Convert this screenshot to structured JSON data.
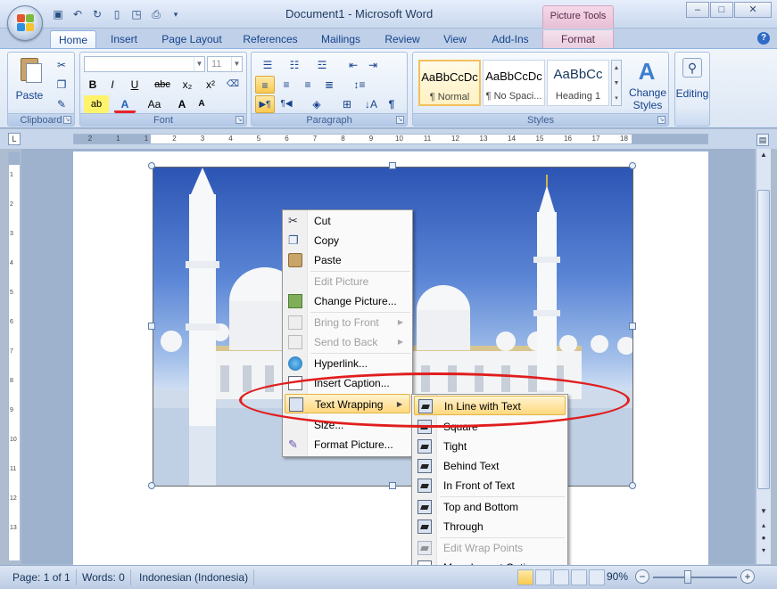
{
  "window": {
    "title": "Document1 - Microsoft Word",
    "context_tools": "Picture Tools",
    "controls": {
      "minimize": "–",
      "maximize": "□",
      "close": "✕"
    }
  },
  "quick_access": [
    "save-icon",
    "undo-icon",
    "redo-icon",
    "print-preview-icon",
    "spelling-icon",
    "print-icon",
    "customize-icon"
  ],
  "tabs": [
    "Home",
    "Insert",
    "Page Layout",
    "References",
    "Mailings",
    "Review",
    "View",
    "Add-Ins",
    "Format"
  ],
  "active_tab": "Home",
  "ribbon": {
    "clipboard": {
      "label": "Clipboard",
      "paste": "Paste"
    },
    "font": {
      "label": "Font",
      "font_name": "",
      "font_size": "11",
      "bold": "B",
      "italic": "I",
      "underline": "U",
      "strike": "abc",
      "subscript": "x₂",
      "superscript": "x²",
      "grow": "A",
      "shrink": "A",
      "case": "Aa"
    },
    "paragraph": {
      "label": "Paragraph"
    },
    "styles": {
      "label": "Styles",
      "items": [
        {
          "sample": "AaBbCcDc",
          "name": "¶ Normal"
        },
        {
          "sample": "AaBbCcDc",
          "name": "¶ No Spaci..."
        },
        {
          "sample": "AaBbCc",
          "name": "Heading 1"
        }
      ],
      "change_styles_1": "Change",
      "change_styles_2": "Styles"
    },
    "editing": {
      "label": "Editing"
    }
  },
  "ruler": {
    "numbers": [
      "2",
      "1",
      "1",
      "2",
      "3",
      "4",
      "5",
      "6",
      "7",
      "8",
      "9",
      "10",
      "11",
      "12",
      "13",
      "14",
      "15",
      "16",
      "17",
      "18"
    ],
    "vnumbers": [
      "1",
      "2",
      "3",
      "4",
      "5",
      "6",
      "7",
      "8",
      "9",
      "10",
      "11",
      "12",
      "13"
    ]
  },
  "context_menu": {
    "items": [
      {
        "label": "Cut",
        "icon": "scissors-icon",
        "enabled": true
      },
      {
        "label": "Copy",
        "icon": "copy-icon",
        "enabled": true
      },
      {
        "label": "Paste",
        "icon": "paste-icon",
        "enabled": true
      },
      {
        "label": "Edit Picture",
        "icon": "",
        "enabled": false
      },
      {
        "label": "Change Picture...",
        "icon": "change-picture-icon",
        "enabled": true
      },
      {
        "label": "Bring to Front",
        "icon": "bring-front-icon",
        "enabled": false,
        "submenu": true
      },
      {
        "label": "Send to Back",
        "icon": "send-back-icon",
        "enabled": false,
        "submenu": true
      },
      {
        "label": "Hyperlink...",
        "icon": "hyperlink-icon",
        "enabled": true
      },
      {
        "label": "Insert Caption...",
        "icon": "caption-icon",
        "enabled": true
      },
      {
        "label": "Text Wrapping",
        "icon": "text-wrapping-icon",
        "enabled": true,
        "submenu": true,
        "highlighted": true
      },
      {
        "label": "Size...",
        "icon": "",
        "enabled": true
      },
      {
        "label": "Format Picture...",
        "icon": "format-picture-icon",
        "enabled": true
      }
    ]
  },
  "wrap_submenu": {
    "items": [
      {
        "label": "In Line with Text",
        "enabled": true,
        "highlighted": true
      },
      {
        "label": "Square",
        "enabled": true
      },
      {
        "label": "Tight",
        "enabled": true
      },
      {
        "label": "Behind Text",
        "enabled": true
      },
      {
        "label": "In Front of Text",
        "enabled": true
      },
      {
        "label": "Top and Bottom",
        "enabled": true
      },
      {
        "label": "Through",
        "enabled": true
      },
      {
        "label": "Edit Wrap Points",
        "enabled": false
      },
      {
        "label": "More Layout Options...",
        "enabled": true
      }
    ]
  },
  "status": {
    "page": "Page: 1 of 1",
    "words": "Words: 0",
    "language": "Indonesian (Indonesia)",
    "zoom": "90%",
    "zoom_minus": "−",
    "zoom_plus": "+"
  },
  "colors": {
    "accent": "#15428b",
    "highlight": "#ffd87e",
    "annotation": "#e01e1e"
  }
}
